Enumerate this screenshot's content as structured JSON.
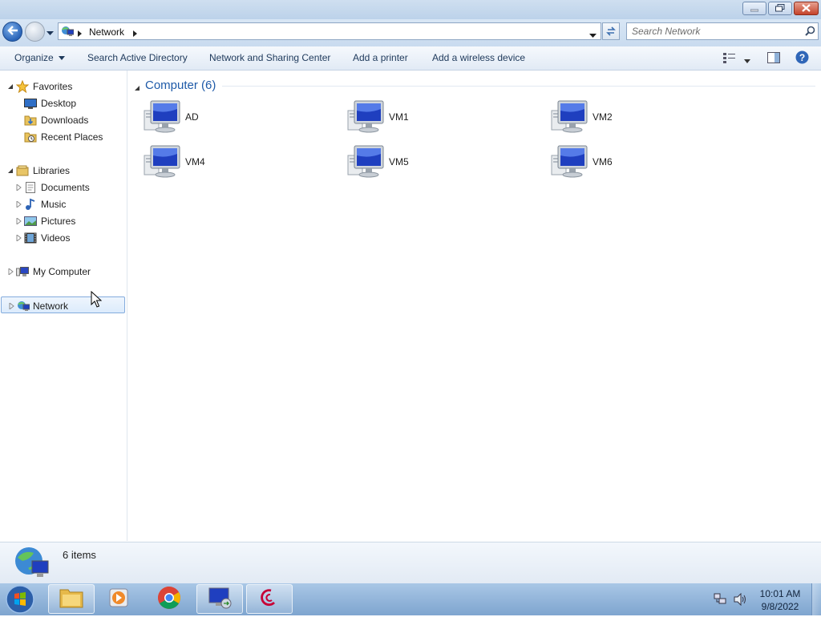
{
  "window": {
    "title_buttons": {
      "minimize": "minimize-icon",
      "maximize": "restore-icon",
      "close": "close-icon"
    }
  },
  "address_bar": {
    "location": "Network",
    "search_placeholder": "Search Network"
  },
  "command_bar": {
    "organize": "Organize",
    "items": [
      "Search Active Directory",
      "Network and Sharing Center",
      "Add a printer",
      "Add a wireless device"
    ]
  },
  "nav": {
    "favorites": {
      "label": "Favorites",
      "items": [
        {
          "label": "Desktop"
        },
        {
          "label": "Downloads"
        },
        {
          "label": "Recent Places"
        }
      ]
    },
    "libraries": {
      "label": "Libraries",
      "items": [
        {
          "label": "Documents"
        },
        {
          "label": "Music"
        },
        {
          "label": "Pictures"
        },
        {
          "label": "Videos"
        }
      ]
    },
    "computer": {
      "label": "My Computer"
    },
    "network": {
      "label": "Network",
      "selected": true
    }
  },
  "main": {
    "group_header": "Computer (6)",
    "computers": [
      {
        "label": "AD"
      },
      {
        "label": "VM1"
      },
      {
        "label": "VM2"
      },
      {
        "label": "VM4"
      },
      {
        "label": "VM5"
      },
      {
        "label": "VM6"
      }
    ]
  },
  "details": {
    "count": "6 items"
  },
  "taskbar": {
    "time": "10:01 AM",
    "date": "9/8/2022",
    "apps": [
      "windows-explorer-icon",
      "media-player-icon",
      "chrome-icon",
      "remote-desktop-icon",
      "debian-icon"
    ]
  },
  "colors": {
    "accent": "#1e5aa8",
    "link": "#1e395b",
    "selection_border": "#84acdd"
  }
}
